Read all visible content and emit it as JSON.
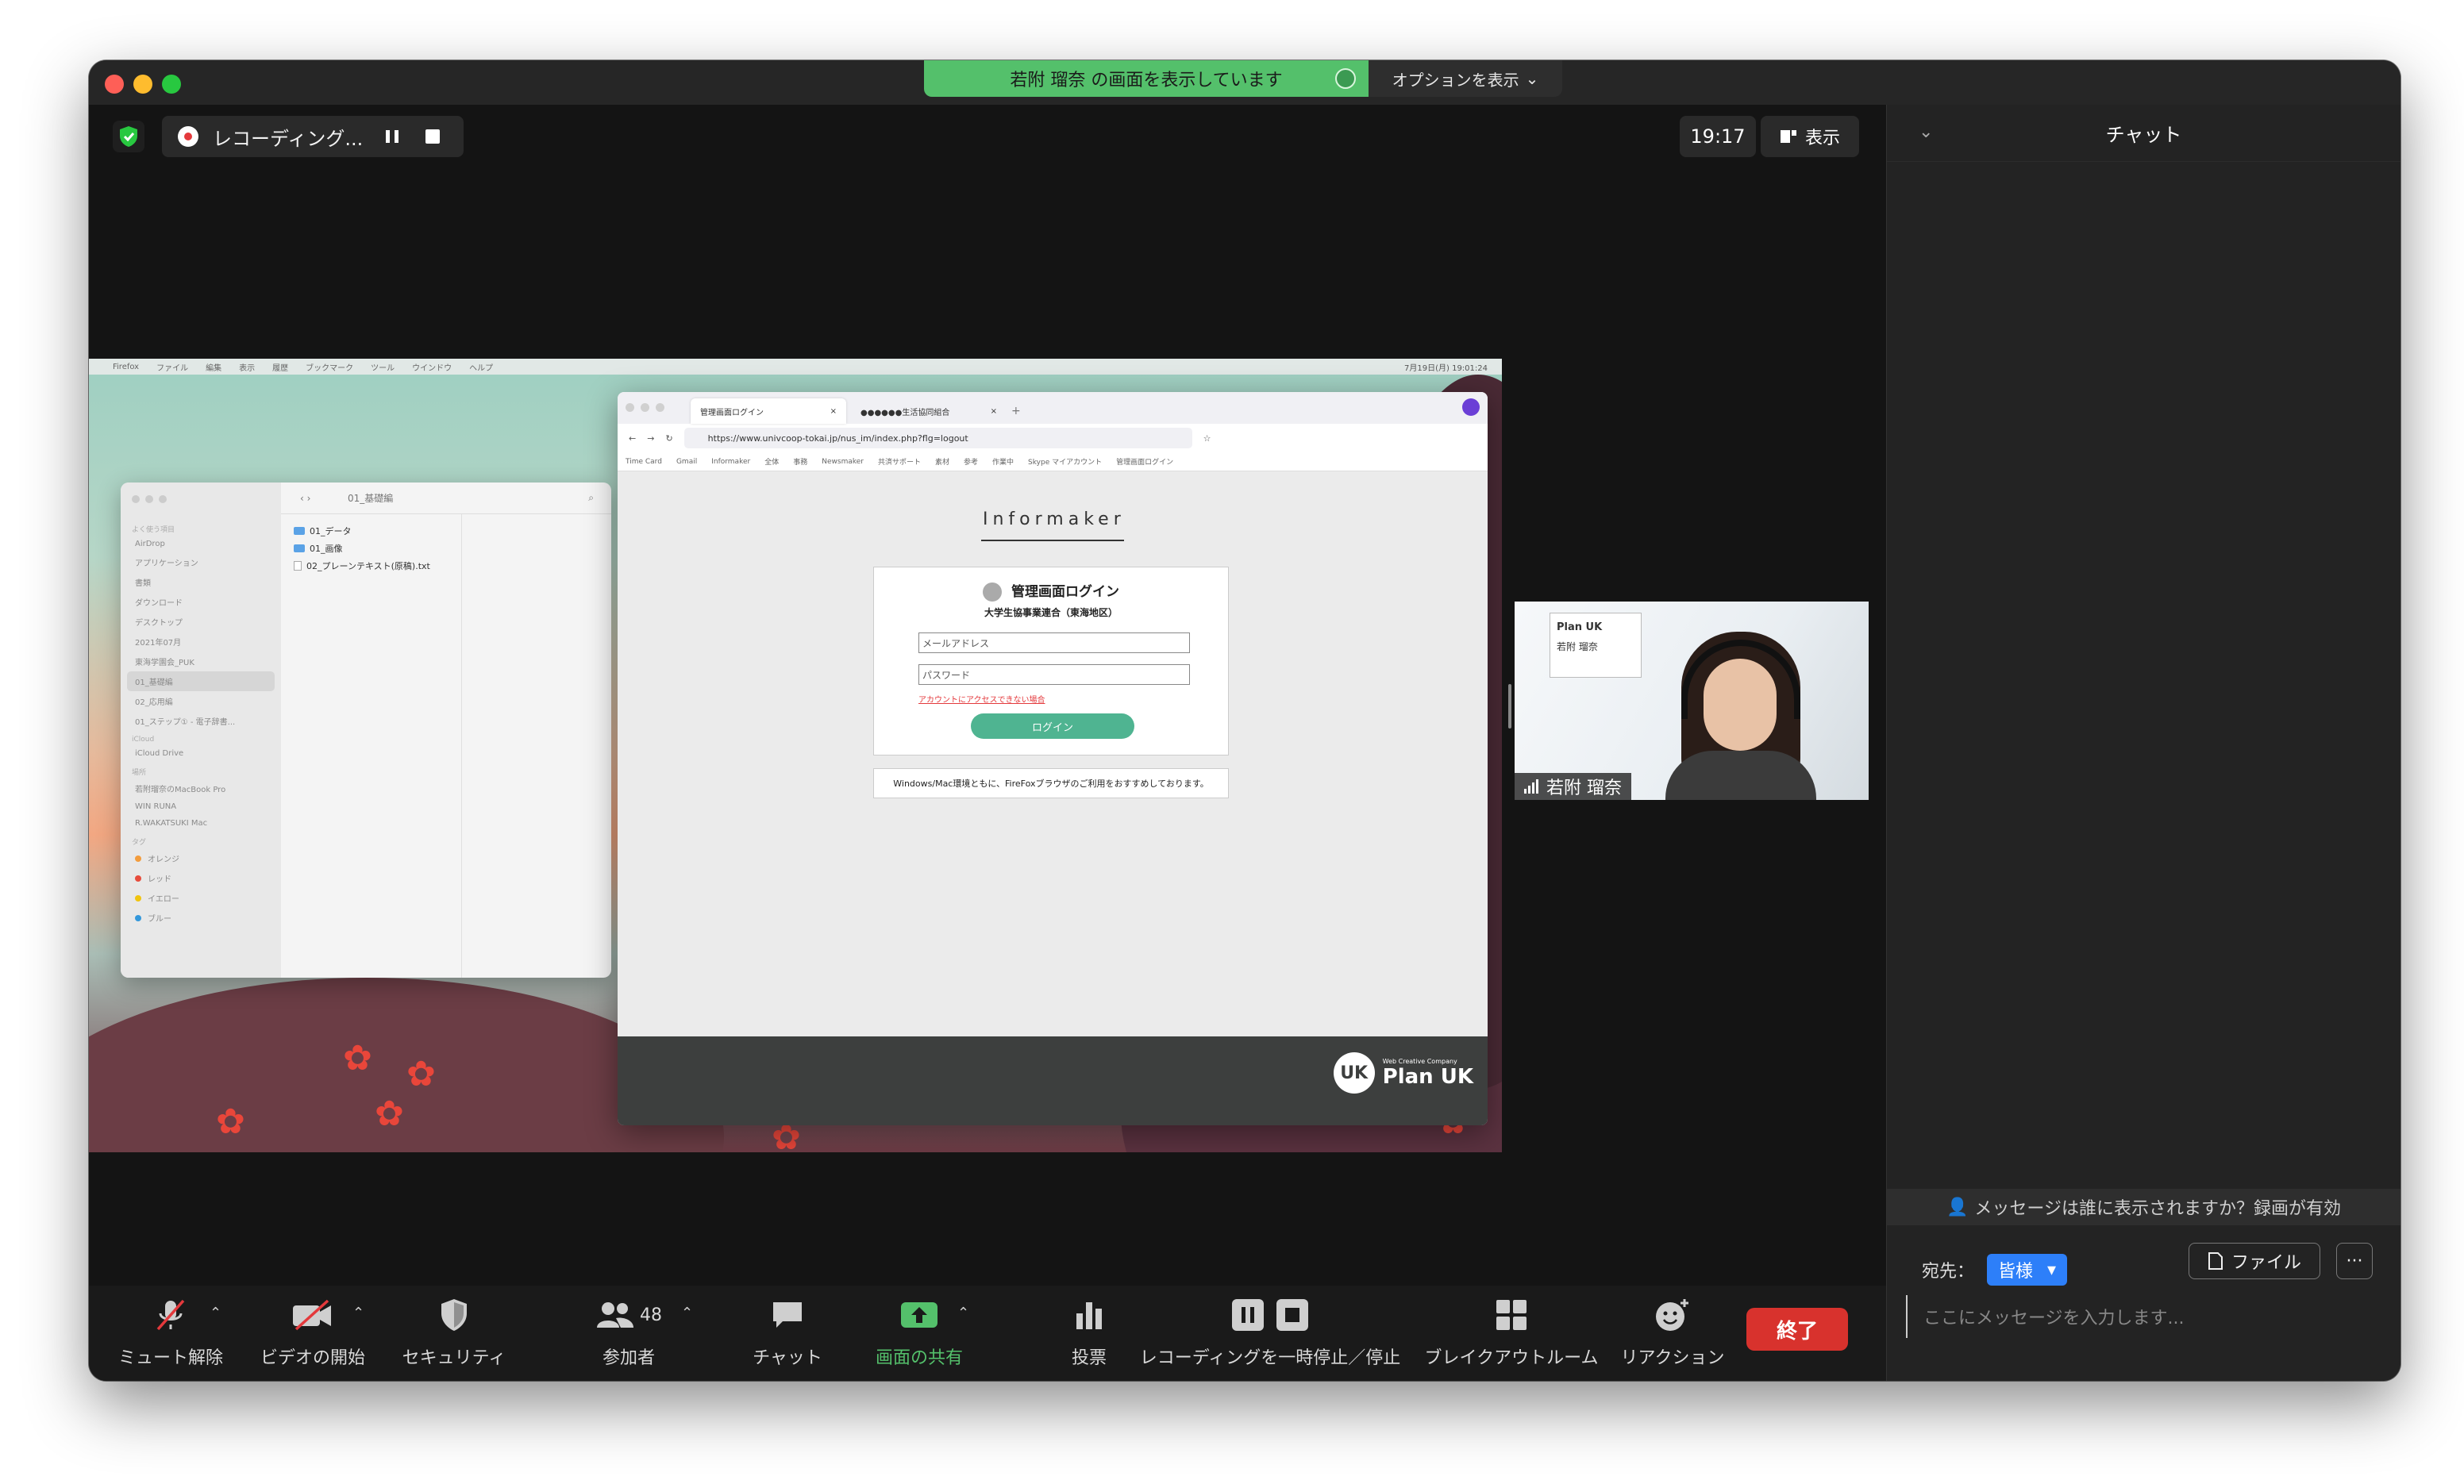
{
  "window": {
    "share_banner": "若附 瑠奈 の画面を表示しています",
    "options": "オプションを表示"
  },
  "top_bar": {
    "recording_label": "レコーディング...",
    "clock": "19:17",
    "view_label": "表示"
  },
  "shared_screen": {
    "menubar": [
      "Firefox",
      "ファイル",
      "編集",
      "表示",
      "履歴",
      "ブックマーク",
      "ツール",
      "ウインドウ",
      "ヘルプ"
    ],
    "menubar_right": "7月19日(月) 19:01:24",
    "finder": {
      "path": "01_基礎編",
      "sidebar_favorites_label": "よく使う項目",
      "sidebar_favorites": [
        "AirDrop",
        "アプリケーション",
        "書類",
        "ダウンロード",
        "デスクトップ",
        "2021年07月",
        "東海学園会_PUK",
        "01_基礎編",
        "02_応用編",
        "01_ステップ① - 電子辞書..."
      ],
      "sidebar_icloud_label": "iCloud",
      "sidebar_icloud": [
        "iCloud Drive"
      ],
      "sidebar_locations_label": "場所",
      "sidebar_locations": [
        "若附瑠奈のMacBook Pro",
        "WIN RUNA",
        "R.WAKATSUKI Mac"
      ],
      "sidebar_tags_label": "タグ",
      "sidebar_tags": [
        {
          "label": "オレンジ",
          "color": "#f39c3d"
        },
        {
          "label": "レッド",
          "color": "#e74c3c"
        },
        {
          "label": "イエロー",
          "color": "#f1c40f"
        },
        {
          "label": "ブルー",
          "color": "#3498db"
        }
      ],
      "files": [
        {
          "name": "01_データ",
          "type": "folder"
        },
        {
          "name": "01_画像",
          "type": "folder"
        },
        {
          "name": "02_プレーンテキスト(原稿).txt",
          "type": "file"
        }
      ]
    },
    "browser": {
      "tab1": "管理画面ログイン",
      "tab2": "●●●●●●生活協同組合",
      "url": "https://www.univcoop-tokai.jp/nus_im/index.php?flg=logout",
      "bookmarks": [
        "Time Card",
        "Gmail",
        "Informaker",
        "全体",
        "事務",
        "Newsmaker",
        "共済サポート",
        "素材",
        "参考",
        "作業中",
        "Skype マイアカウント",
        "管理画面ログイン"
      ],
      "logo": "Informaker",
      "login_title": "管理画面ログイン",
      "login_subtitle": "大学生協事業連合（東海地区）",
      "email_placeholder": "メールアドレス",
      "password_placeholder": "パスワード",
      "help_link": "アカウントにアクセスできない場合",
      "login_button": "ログイン",
      "notice": "Windows/Mac環境ともに、FireFoxブラウザのご利用をおすすめしております。",
      "footer_brand_small": "Web Creative Company",
      "footer_brand": "Plan UK",
      "footer_mark": "UK"
    }
  },
  "participant": {
    "name": "若附 瑠奈",
    "card_brand": "Plan UK",
    "card_name": "若附 瑠奈"
  },
  "toolbar": {
    "mute": "ミュート解除",
    "video": "ビデオの開始",
    "security": "セキュリティ",
    "participants": "参加者",
    "participants_count": "48",
    "chat": "チャット",
    "share": "画面の共有",
    "poll": "投票",
    "recording": "レコーディングを一時停止／停止",
    "breakout": "ブレイクアウトルーム",
    "reactions": "リアクション",
    "end": "終了"
  },
  "chat": {
    "title": "チャット",
    "visibility_notice": "メッセージは誰に表示されますか？録画が有効",
    "to_label": "宛先：",
    "recipient": "皆様",
    "file_button": "ファイル",
    "more": "···",
    "placeholder": "ここにメッセージを入力します..."
  },
  "colors": {
    "share_green": "#54c06b",
    "end_red": "#d8322d",
    "recipient_blue": "#2d7ff9",
    "login_green": "#4fb491"
  }
}
